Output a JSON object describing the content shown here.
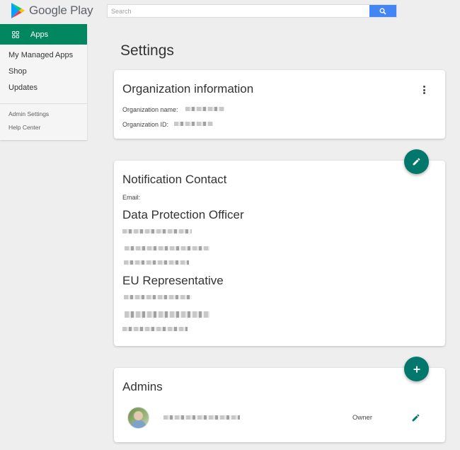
{
  "header": {
    "brand": "Google Play",
    "search_placeholder": "Search",
    "search_value": "",
    "search_icon": "search-icon"
  },
  "sidebar": {
    "active": {
      "label": "Apps",
      "icon": "apps-grid-icon"
    },
    "items": [
      {
        "label": "My Managed Apps"
      },
      {
        "label": "Shop"
      },
      {
        "label": "Updates"
      }
    ],
    "secondary": [
      {
        "label": "Admin Settings"
      },
      {
        "label": "Help Center"
      }
    ]
  },
  "page": {
    "title": "Settings"
  },
  "org_card": {
    "title": "Organization information",
    "name_label": "Organization name:",
    "id_label": "Organization ID:",
    "menu_icon": "more-vert-icon"
  },
  "notification_card": {
    "title": "Notification Contact",
    "email_label": "Email:",
    "dpo_title": "Data Protection Officer",
    "eu_title": "EU Representative",
    "edit_icon": "edit-icon"
  },
  "admins_card": {
    "title": "Admins",
    "add_icon": "add-icon",
    "admins": [
      {
        "role": "Owner",
        "edit_icon": "edit-icon"
      }
    ]
  },
  "colors": {
    "brand_green": "#01875f",
    "fab_teal": "#01786b",
    "search_blue": "#4285f4",
    "background": "#eeeeee"
  }
}
